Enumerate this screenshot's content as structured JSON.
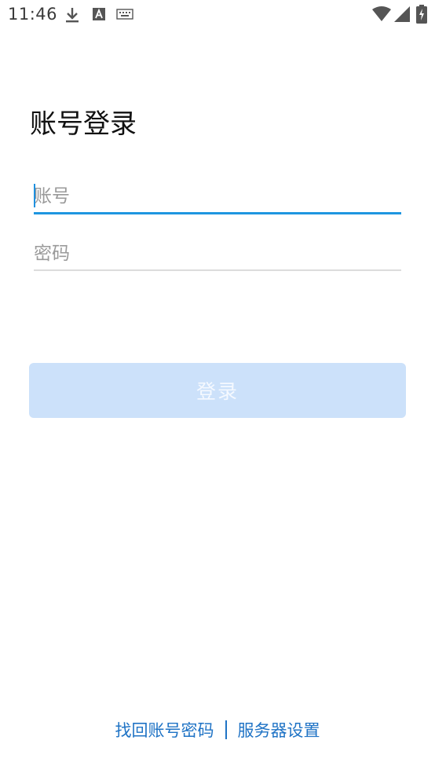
{
  "status_bar": {
    "time": "11:46",
    "icons": [
      "download-icon",
      "a-notification-icon",
      "keyboard-icon",
      "wifi-icon",
      "signal-icon",
      "battery-charging-icon"
    ]
  },
  "login": {
    "title": "账号登录",
    "account_placeholder": "账号",
    "password_placeholder": "密码",
    "login_button_label": "登录"
  },
  "footer": {
    "forgot_password": "找回账号密码",
    "server_settings": "服务器设置"
  },
  "colors": {
    "accent_blue": "#1E96E0",
    "button_disabled_bg": "#CCE1FA",
    "link_blue": "#1F73C5"
  }
}
